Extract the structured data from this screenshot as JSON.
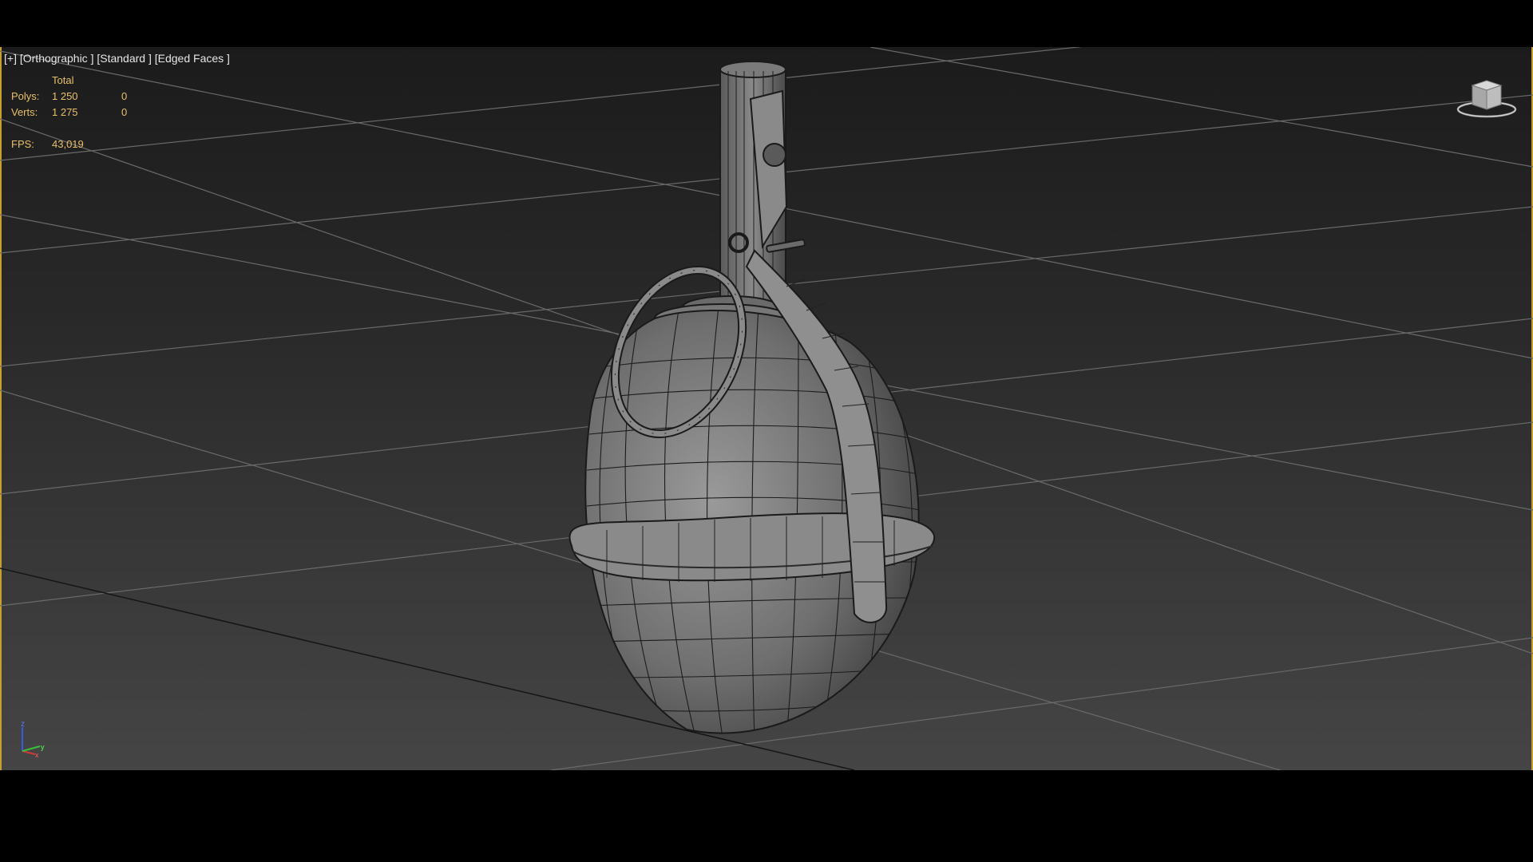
{
  "viewport": {
    "label_plus": "[+]",
    "label_view": "[Orthographic ]",
    "label_shading": "[Standard ]",
    "label_edges": "[Edged Faces ]"
  },
  "stats": {
    "total_header": "Total",
    "polys_label": "Polys:",
    "polys_total": "1 250",
    "polys_selected": "0",
    "verts_label": "Verts:",
    "verts_total": "1 275",
    "verts_selected": "0",
    "fps_label": "FPS:",
    "fps_value": "43,019"
  },
  "axis": {
    "z": "z",
    "x": "x",
    "y": "y"
  },
  "colors": {
    "viewport_border": "#c8a030",
    "stats_text": "#e8c06a",
    "label_text": "#e6e6e6",
    "grid_line": "#6a6a6a",
    "mesh_fill": "#7a7a7a",
    "wire": "#1a1a1a"
  },
  "icons": [
    "viewcube-icon",
    "axis-tripod-icon"
  ]
}
